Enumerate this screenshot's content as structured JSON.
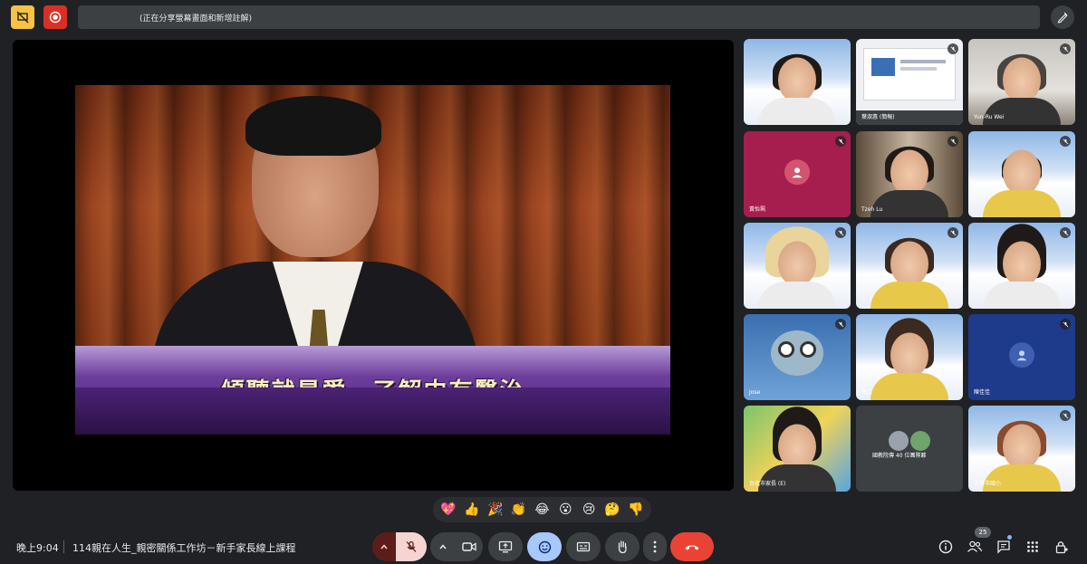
{
  "window": {
    "share_banner": "(正在分享螢幕畫面和新增註解)"
  },
  "presentation": {
    "subtitle": "傾聽就是愛，了解中有醫治"
  },
  "participants": [
    {
      "name": ""
    },
    {
      "name": "葉淑惠 (簡報)"
    },
    {
      "name": "Yun-Ru Wei"
    },
    {
      "name": "黃怡珮"
    },
    {
      "name": "Tzeh Lu"
    },
    {
      "name": ""
    },
    {
      "name": ""
    },
    {
      "name": ""
    },
    {
      "name": ""
    },
    {
      "name": "Jose"
    },
    {
      "name": "徐文"
    },
    {
      "name": "陳佳佳"
    },
    {
      "name": "台北市家長 (E)"
    },
    {
      "name": "國教院傳 40 位團隊夥"
    },
    {
      "name": "北市市國小"
    }
  ],
  "reactions": {
    "items": [
      "💖",
      "👍",
      "🎉",
      "👏",
      "😂",
      "😮",
      "😢",
      "🤔",
      "👎"
    ]
  },
  "status": {
    "time": "晚上9:04",
    "meeting_title": "114親在人生_親密關係工作坊－新手家長線上課程",
    "participant_count": "25"
  },
  "colors": {
    "hangup": "#ea4335",
    "emoji_active": "#a8c7fa",
    "mic_off": "#f6d4d1",
    "no_present_badge": "#f6c343",
    "record": "#d93025"
  }
}
